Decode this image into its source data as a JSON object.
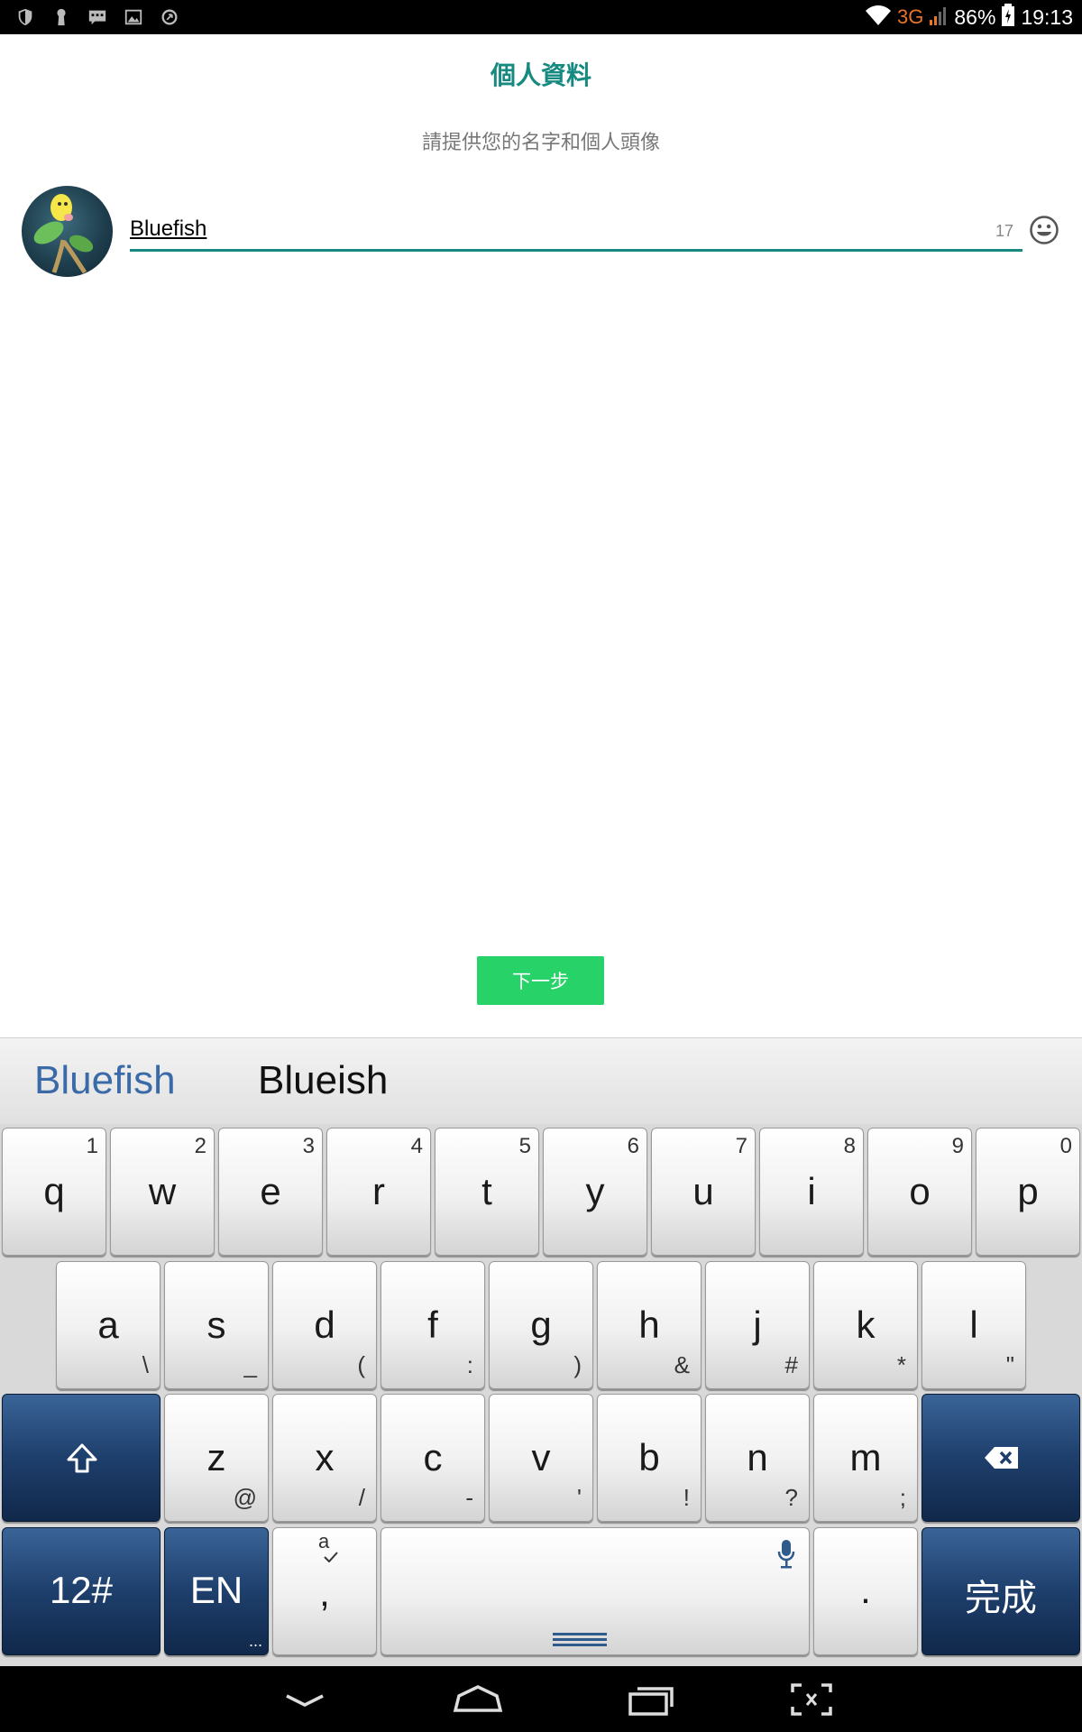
{
  "status_bar": {
    "network_label": "3G",
    "battery_percent": "86%",
    "time": "19:13",
    "left_icons": [
      "shield-icon",
      "keyhole-icon",
      "chat-icon",
      "image-icon",
      "sync-icon"
    ]
  },
  "profile": {
    "title": "個人資料",
    "subtitle": "請提供您的名字和個人頭像",
    "name_value": "Bluefish",
    "char_counter": "17",
    "next_label": "下一步"
  },
  "keyboard": {
    "suggestions": [
      "Bluefish",
      "Blueish"
    ],
    "row1": [
      {
        "k": "q",
        "h": "1"
      },
      {
        "k": "w",
        "h": "2"
      },
      {
        "k": "e",
        "h": "3"
      },
      {
        "k": "r",
        "h": "4"
      },
      {
        "k": "t",
        "h": "5"
      },
      {
        "k": "y",
        "h": "6"
      },
      {
        "k": "u",
        "h": "7"
      },
      {
        "k": "i",
        "h": "8"
      },
      {
        "k": "o",
        "h": "9"
      },
      {
        "k": "p",
        "h": "0"
      }
    ],
    "row2": [
      {
        "k": "a",
        "h": "\\"
      },
      {
        "k": "s",
        "h": "_"
      },
      {
        "k": "d",
        "h": "("
      },
      {
        "k": "f",
        "h": ":"
      },
      {
        "k": "g",
        "h": ")"
      },
      {
        "k": "h",
        "h": "&"
      },
      {
        "k": "j",
        "h": "#"
      },
      {
        "k": "k",
        "h": "*"
      },
      {
        "k": "l",
        "h": "\""
      }
    ],
    "row3": [
      {
        "k": "z",
        "h": "@"
      },
      {
        "k": "x",
        "h": "/"
      },
      {
        "k": "c",
        "h": "-"
      },
      {
        "k": "v",
        "h": "'"
      },
      {
        "k": "b",
        "h": "!"
      },
      {
        "k": "n",
        "h": "?"
      },
      {
        "k": "m",
        "h": ";"
      }
    ],
    "symbols_label": "12#",
    "language_label": "EN",
    "language_more": "...",
    "comma_label": ",",
    "comma_hint": "a",
    "period_label": ".",
    "done_label": "完成"
  },
  "colors": {
    "accent": "#168a80",
    "next_button": "#27d268",
    "suggestion_primary": "#3a6aa8",
    "dark_key": "#1e3f6c"
  }
}
